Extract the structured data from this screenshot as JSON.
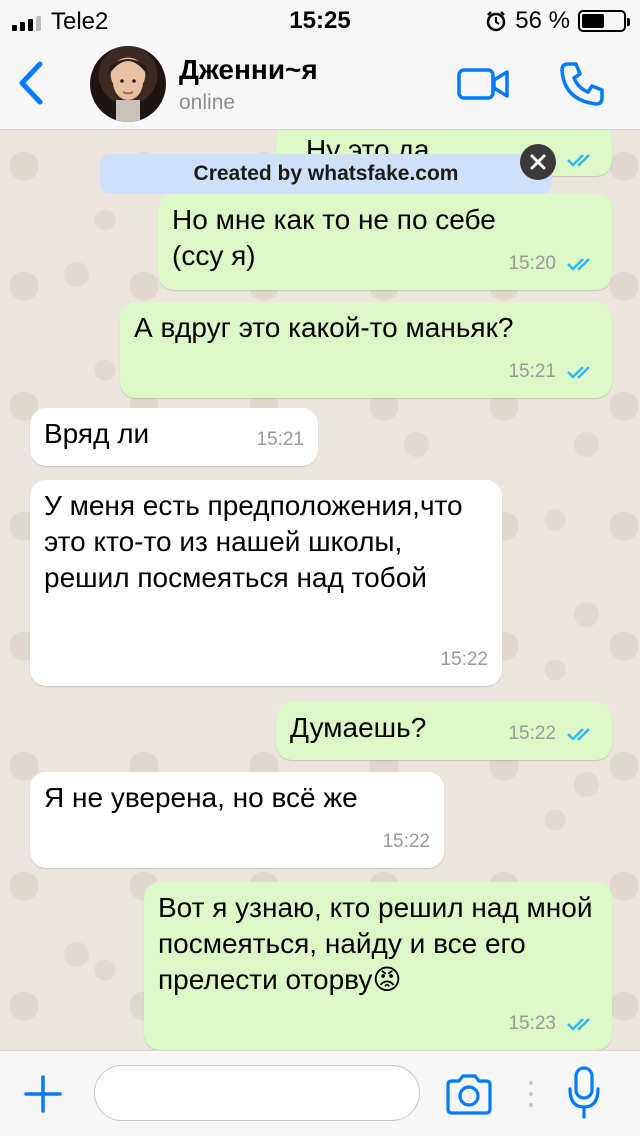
{
  "status_bar": {
    "carrier": "Tele2",
    "time": "15:25",
    "battery": "56 %"
  },
  "header": {
    "contact_name": "Дженни~я",
    "contact_status": "online"
  },
  "watermark": {
    "text": "Created by whatsfake.com"
  },
  "messages": [
    {
      "direction": "out",
      "text": "Ну это да",
      "time": "",
      "read": true
    },
    {
      "direction": "out",
      "text": "Но мне как то не по себе (ссу я)",
      "time": "15:20",
      "read": true
    },
    {
      "direction": "out",
      "text": "А вдруг это какой-то маньяк?",
      "time": "15:21",
      "read": true
    },
    {
      "direction": "in",
      "text": "Вряд ли",
      "time": "15:21"
    },
    {
      "direction": "in",
      "text": "У меня есть предположения,что это кто-то из нашей школы, решил посмеяться над тобой",
      "time": "15:22"
    },
    {
      "direction": "out",
      "text": "Думаешь?",
      "time": "15:22",
      "read": true
    },
    {
      "direction": "in",
      "text": "Я не уверена, но всё же",
      "time": "15:22"
    },
    {
      "direction": "out",
      "text": "Вот я узнаю, кто решил над мной посмеяться, найду и все его прелести оторву",
      "emoji": "😡",
      "time": "15:23",
      "read": true
    }
  ],
  "input": {
    "value": "",
    "placeholder": ""
  },
  "icons": {
    "back": "chevron-left-icon",
    "video": "video-camera-icon",
    "call": "phone-icon",
    "plus": "plus-icon",
    "camera": "camera-icon",
    "mic": "microphone-icon",
    "read_receipt": "double-check-icon",
    "alarm": "alarm-clock-icon"
  },
  "colors": {
    "accent": "#007aff",
    "outgoing_bubble": "#dcf8c6",
    "incoming_bubble": "#ffffff",
    "read_tick": "#34b7f1"
  }
}
